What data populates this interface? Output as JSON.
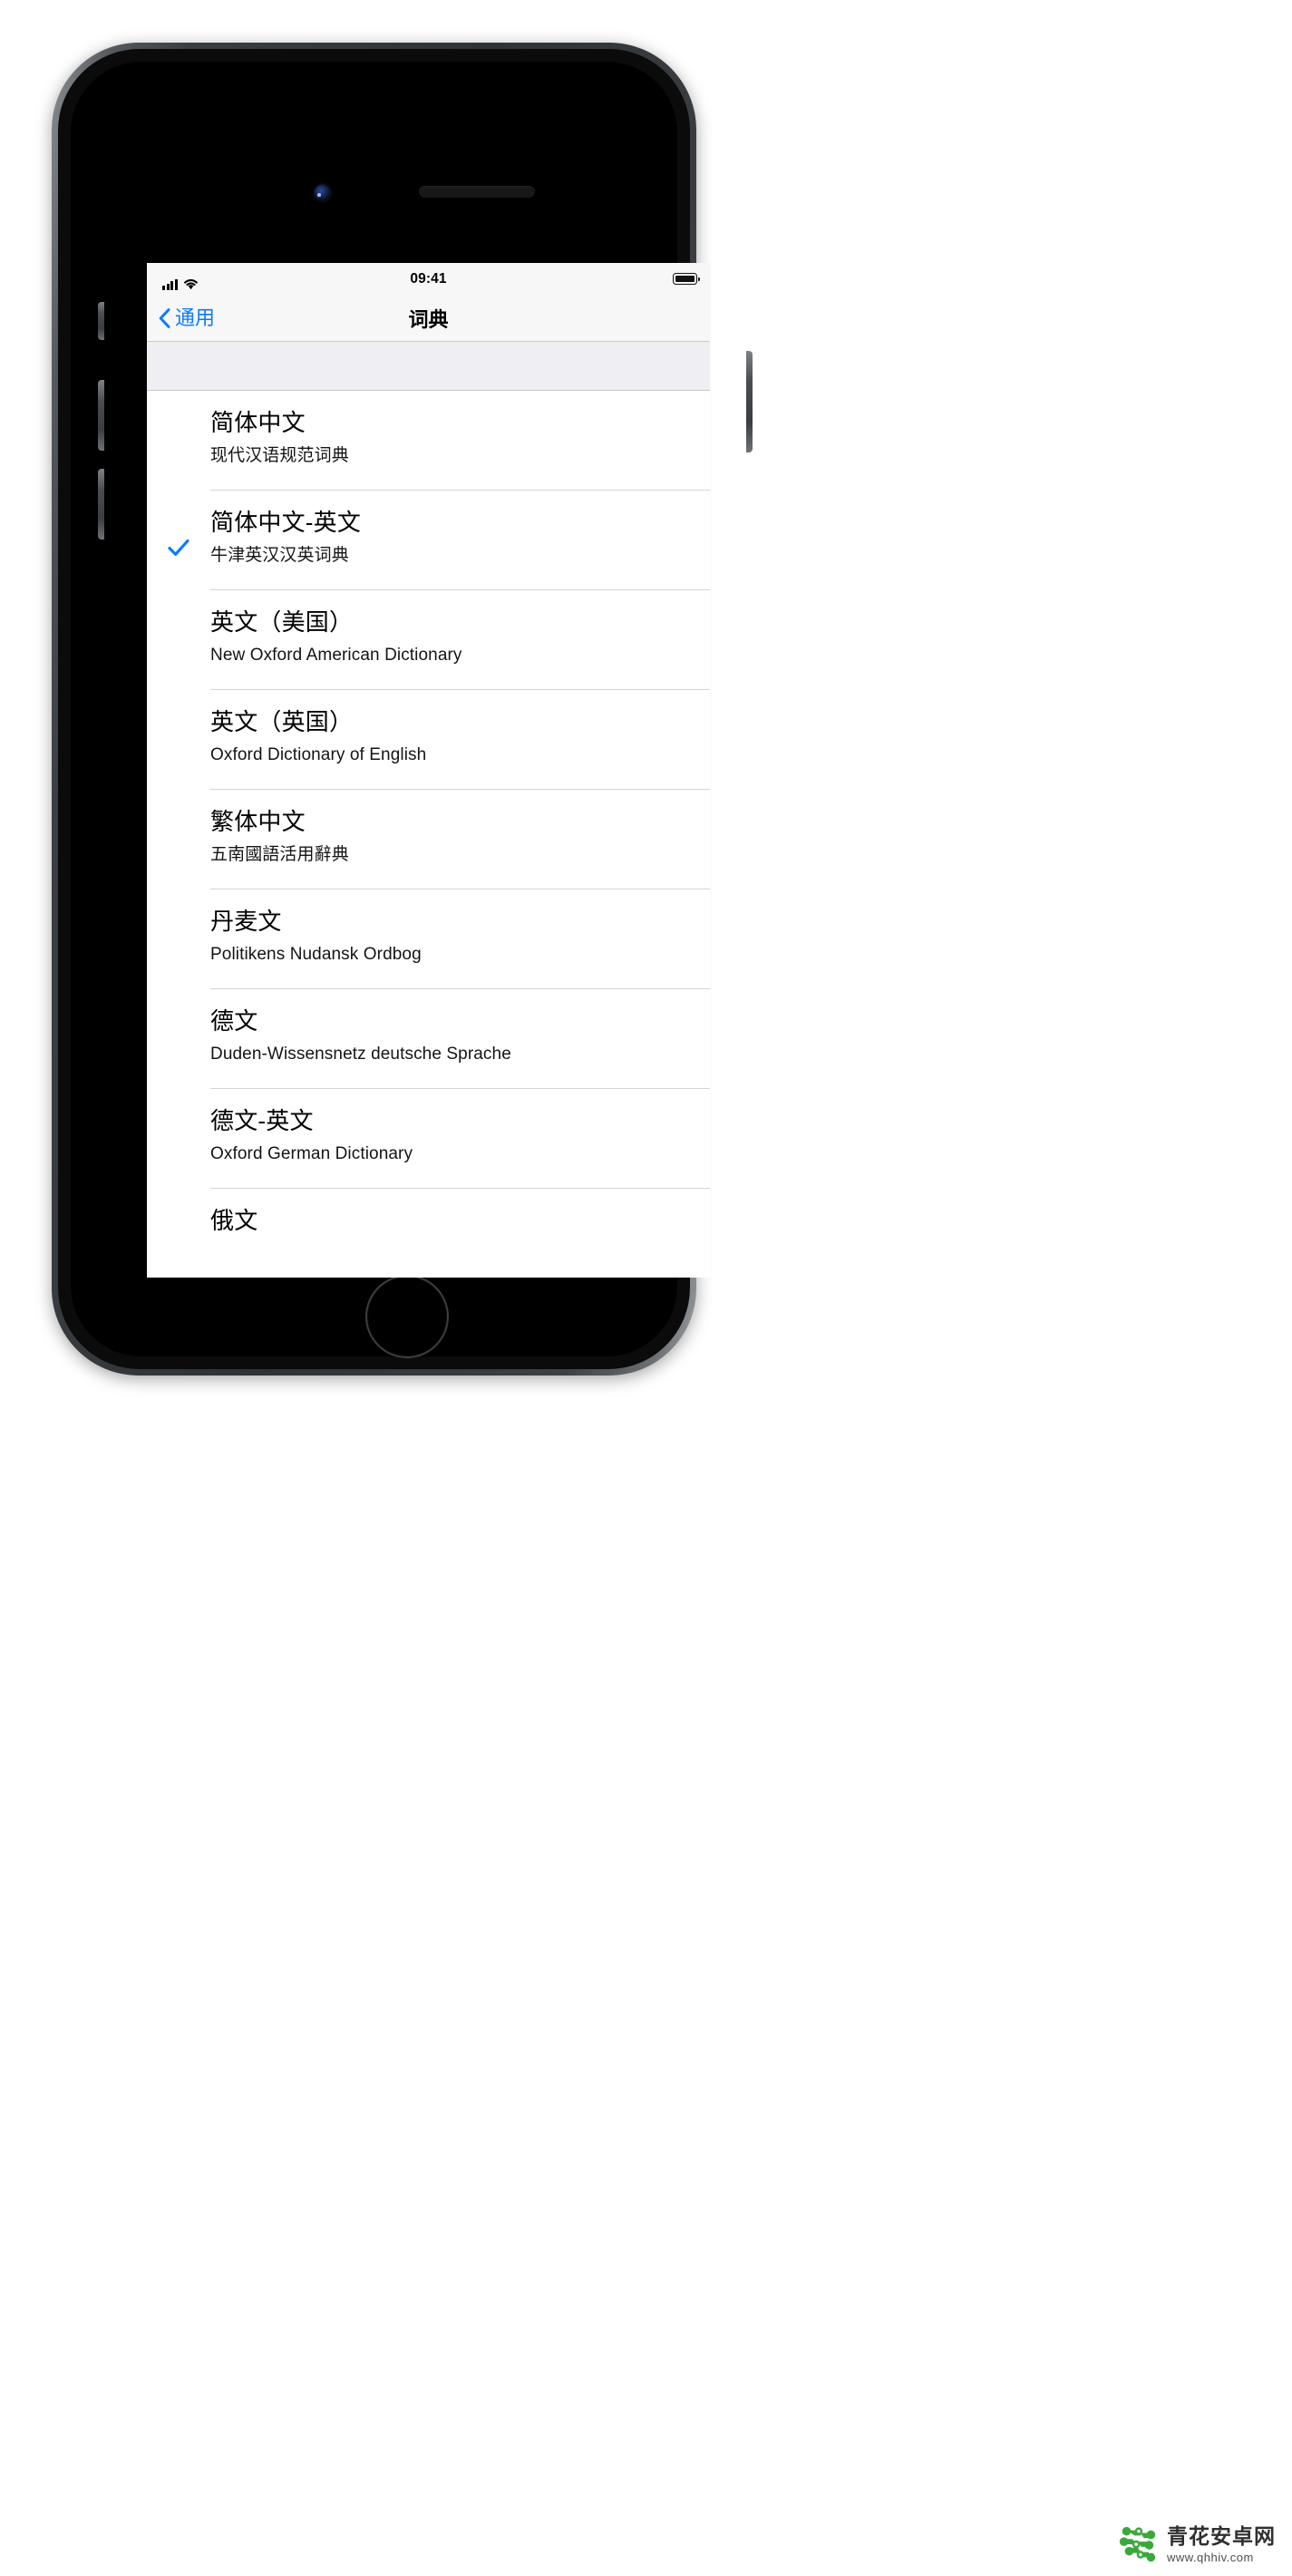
{
  "status_bar": {
    "time": "09:41",
    "signal_icon": "cellular-signal-icon",
    "wifi_icon": "wifi-icon",
    "battery_icon": "battery-full-icon"
  },
  "nav": {
    "back_label": "通用",
    "back_icon": "chevron-left-icon",
    "title": "词典"
  },
  "colors": {
    "accent_blue": "#0a7cff",
    "bar_background": "#f7f7f8",
    "section_gap": "#eeeef3",
    "separator": "#d4d4d8",
    "watermark_green": "#3aa93a"
  },
  "dictionaries": [
    {
      "title": "简体中文",
      "subtitle": "现代汉语规范词典",
      "selected": false
    },
    {
      "title": "简体中文-英文",
      "subtitle": "牛津英汉汉英词典",
      "selected": true
    },
    {
      "title": "英文（美国）",
      "subtitle": "New Oxford American Dictionary",
      "selected": false
    },
    {
      "title": "英文（英国）",
      "subtitle": "Oxford Dictionary of English",
      "selected": false
    },
    {
      "title": "繁体中文",
      "subtitle": "五南國語活用辭典",
      "selected": false
    },
    {
      "title": "丹麦文",
      "subtitle": "Politikens Nudansk Ordbog",
      "selected": false
    },
    {
      "title": "德文",
      "subtitle": "Duden-Wissensnetz deutsche Sprache",
      "selected": false
    },
    {
      "title": "德文-英文",
      "subtitle": "Oxford German Dictionary",
      "selected": false
    },
    {
      "title": "俄文",
      "subtitle": "",
      "selected": false
    }
  ],
  "watermark": {
    "name": "青花安卓网",
    "url": "www.qhhiv.com",
    "logo_icon": "molecule-logo-icon"
  }
}
